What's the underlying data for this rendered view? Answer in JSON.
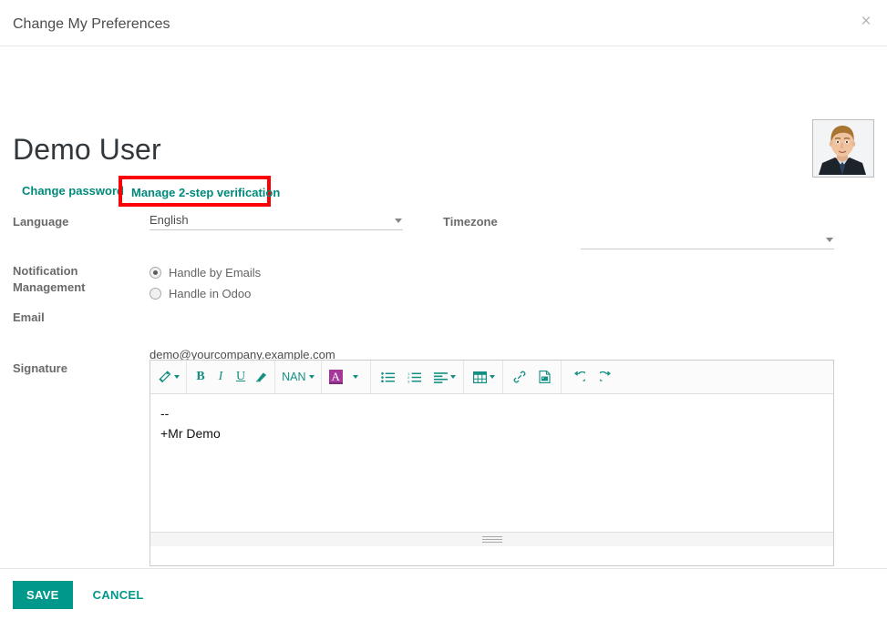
{
  "modal": {
    "title": "Change My Preferences",
    "close_label": "×"
  },
  "record": {
    "name": "Demo User",
    "avatar_alt": "user-photo"
  },
  "actions": {
    "change_password": "Change password",
    "two_step_verification": "Manage 2-step verification",
    "highlight_color": "#fb0007"
  },
  "form": {
    "language": {
      "label": "Language",
      "value": "English",
      "placeholder": ""
    },
    "timezone": {
      "label": "Timezone",
      "value": "",
      "placeholder": ""
    },
    "notification": {
      "label": "Notification Management",
      "label_line1": "Notification",
      "label_line2": "Management",
      "options": [
        {
          "label": "Handle by Emails",
          "selected": true
        },
        {
          "label": "Handle in Odoo",
          "selected": false
        }
      ]
    },
    "email": {
      "label": "Email",
      "value": "demo@yourcompany.example.com",
      "placeholder": ""
    },
    "signature": {
      "label": "Signature",
      "line1": "--",
      "line2": "+Mr Demo"
    }
  },
  "editor_toolbar": {
    "style_label": "style-magic-wand",
    "bold": "B",
    "italic": "I",
    "underline": "U",
    "clear_format": "eraser-icon",
    "font_size": "NAN",
    "font_color": "A",
    "unordered_list": "unordered-list-icon",
    "ordered_list": "ordered-list-icon",
    "paragraph_align": "align-left-icon",
    "table": "table-icon",
    "link": "link-icon",
    "picture": "picture-icon",
    "undo": "undo-icon",
    "redo": "redo-icon"
  },
  "footer": {
    "save_label": "SAVE",
    "cancel_label": "CANCEL"
  },
  "theme": {
    "accent": "#00988a",
    "link": "#00897b",
    "toolbar_icon": "#128f82",
    "font_color_swatch": "#a6379a"
  }
}
